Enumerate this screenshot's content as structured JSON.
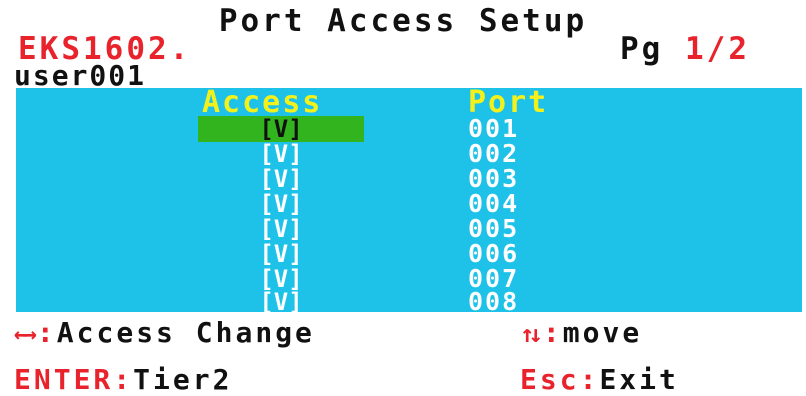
{
  "header": {
    "title": "Port Access Setup",
    "model": "EKS1602.",
    "page_label": "Pg",
    "page_value": "1/2",
    "user": "user001"
  },
  "table": {
    "col_access": "Access",
    "col_port": "Port",
    "rows": [
      {
        "access": "[V]",
        "port": "001",
        "selected": true
      },
      {
        "access": "[V]",
        "port": "002"
      },
      {
        "access": "[V]",
        "port": "003"
      },
      {
        "access": "[V]",
        "port": "004"
      },
      {
        "access": "[V]",
        "port": "005"
      },
      {
        "access": "[V]",
        "port": "006"
      },
      {
        "access": "[V]",
        "port": "007"
      },
      {
        "access": "[V]",
        "port": "008"
      }
    ]
  },
  "footer": {
    "lr_icon": "left-right-arrows-icon",
    "lr_colon": ":",
    "lr_label": "Access Change",
    "ud_icon": "up-down-arrows-icon",
    "ud_colon": ":",
    "ud_label": "move",
    "enter_key": "ENTER",
    "enter_colon": ":",
    "enter_label": "Tier2",
    "esc_key": "Esc",
    "esc_colon": ":",
    "esc_label": "Exit"
  },
  "colors": {
    "panel": "#1ec2e8",
    "header_text": "#f4f11a",
    "accent_red": "#e8232c",
    "selection": "#32b41e"
  }
}
